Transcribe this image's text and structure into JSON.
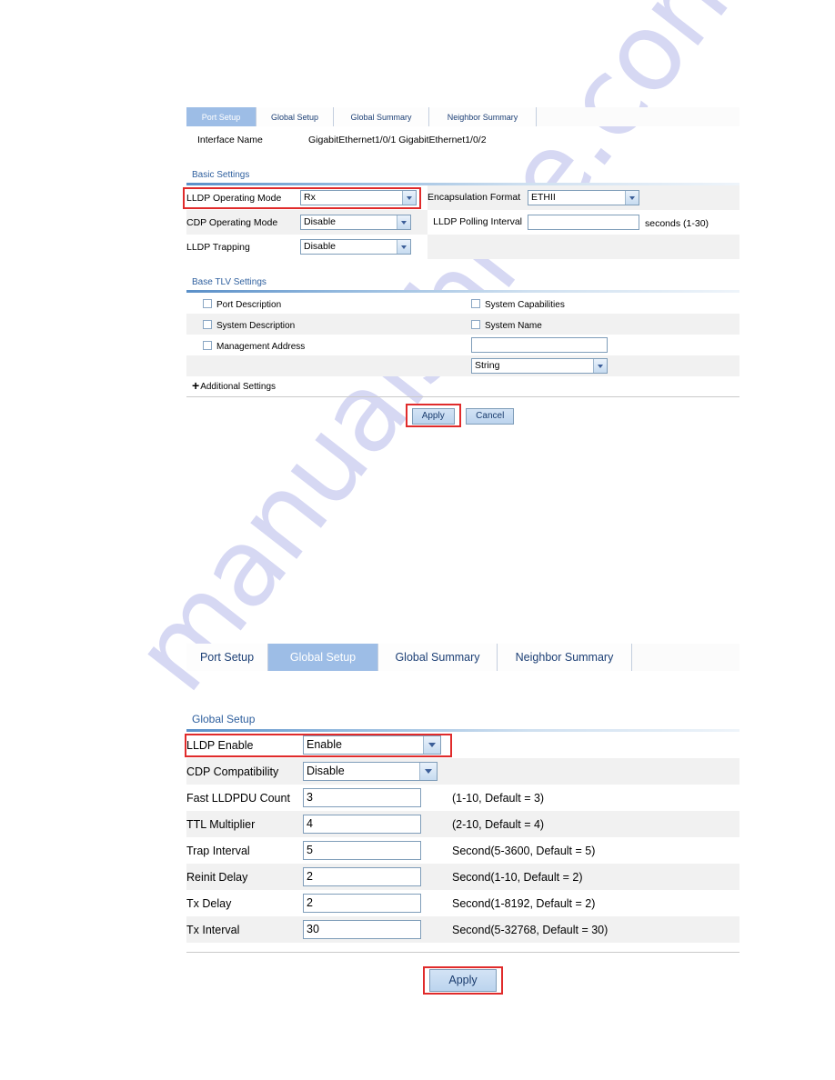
{
  "watermark": {
    "text": "manualshive.com"
  },
  "port_setup_panel": {
    "tabs": [
      {
        "label": "Port Setup",
        "active": true
      },
      {
        "label": "Global Setup",
        "active": false
      },
      {
        "label": "Global Summary",
        "active": false
      },
      {
        "label": "Neighbor Summary",
        "active": false
      }
    ],
    "interface": {
      "label": "Interface Name",
      "value": "GigabitEthernet1/0/1 GigabitEthernet1/0/2"
    },
    "basic_settings": {
      "title": "Basic Settings",
      "lldp_operating_mode": {
        "label": "LLDP Operating Mode",
        "value": "Rx",
        "highlighted": true
      },
      "encapsulation_format": {
        "label": "Encapsulation Format",
        "value": "ETHII"
      },
      "cdp_operating_mode": {
        "label": "CDP Operating Mode",
        "value": "Disable"
      },
      "lldp_polling_interval": {
        "label": "LLDP Polling Interval",
        "value": "",
        "hint": "seconds (1-30)"
      },
      "lldp_trapping": {
        "label": "LLDP Trapping",
        "value": "Disable"
      }
    },
    "base_tlv_settings": {
      "title": "Base TLV Settings",
      "checkboxes": [
        {
          "label": "Port Description",
          "checked": false
        },
        {
          "label": "System Capabilities",
          "checked": false
        },
        {
          "label": "System Description",
          "checked": false
        },
        {
          "label": "System Name",
          "checked": false
        },
        {
          "label": "Management Address",
          "checked": false
        }
      ],
      "mgmt_address_value": "",
      "mgmt_address_type": "String"
    },
    "additional_settings": {
      "label": "Additional Settings",
      "icon": "plus-icon"
    },
    "buttons": {
      "apply": "Apply",
      "cancel": "Cancel",
      "apply_highlighted": true
    }
  },
  "global_setup_panel": {
    "tabs": [
      {
        "label": "Port Setup",
        "active": false
      },
      {
        "label": "Global Setup",
        "active": true
      },
      {
        "label": "Global Summary",
        "active": false
      },
      {
        "label": "Neighbor Summary",
        "active": false
      }
    ],
    "section_title": "Global Setup",
    "rows": [
      {
        "label": "LLDP Enable",
        "value": "Enable",
        "kind": "select",
        "hint": "",
        "highlighted": true
      },
      {
        "label": "CDP Compatibility",
        "value": "Disable",
        "kind": "select",
        "hint": "",
        "highlighted": false
      },
      {
        "label": "Fast LLDPDU Count",
        "value": "3",
        "kind": "input",
        "hint": "(1-10, Default = 3)",
        "highlighted": false
      },
      {
        "label": "TTL Multiplier",
        "value": "4",
        "kind": "input",
        "hint": "(2-10, Default = 4)",
        "highlighted": false
      },
      {
        "label": "Trap Interval",
        "value": "5",
        "kind": "input",
        "hint": "Second(5-3600, Default = 5)",
        "highlighted": false
      },
      {
        "label": "Reinit Delay",
        "value": "2",
        "kind": "input",
        "hint": "Second(1-10, Default = 2)",
        "highlighted": false
      },
      {
        "label": "Tx Delay",
        "value": "2",
        "kind": "input",
        "hint": "Second(1-8192, Default = 2)",
        "highlighted": false
      },
      {
        "label": "Tx Interval",
        "value": "30",
        "kind": "input",
        "hint": "Second(5-32768, Default = 30)",
        "highlighted": false
      }
    ],
    "buttons": {
      "apply": "Apply",
      "apply_highlighted": true
    }
  },
  "colors": {
    "tab_active_bg": "#9dbde6",
    "section_title": "#2e5f9e",
    "highlight_red": "#e02b2b",
    "row_alt_bg": "#f1f1f1",
    "watermark": "#c9cbef"
  }
}
